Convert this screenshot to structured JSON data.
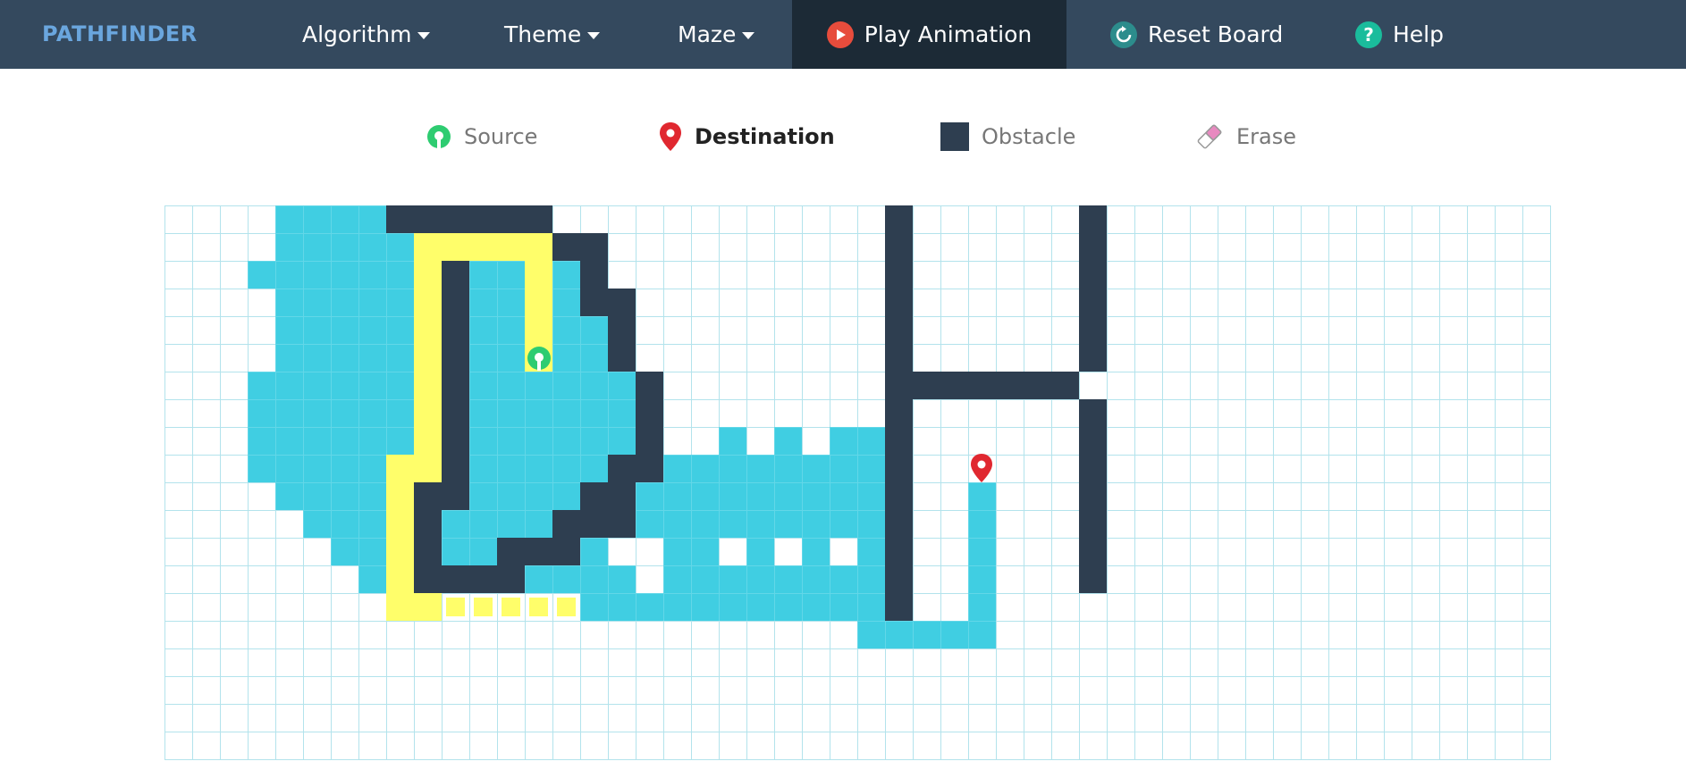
{
  "brand": "PATHFINDER",
  "nav": {
    "algorithm": "Algorithm",
    "theme": "Theme",
    "maze": "Maze",
    "play": "Play Animation",
    "reset": "Reset Board",
    "help": "Help"
  },
  "legend": {
    "source": "Source",
    "destination": "Destination",
    "obstacle": "Obstacle",
    "erase": "Erase"
  },
  "colors": {
    "nav_bg": "#34495e",
    "nav_active": "#1c2a36",
    "wall": "#2e3e50",
    "visited": "#40cee2",
    "path": "#fffe6a",
    "source": "#2ecc71",
    "destination": "#e02830",
    "grid_line": "#b3e3ec"
  },
  "grid": {
    "cols": 50,
    "rows": 20,
    "source": [
      13,
      5
    ],
    "destination": [
      29,
      10
    ],
    "walls": [
      [
        8,
        0
      ],
      [
        9,
        0
      ],
      [
        10,
        0
      ],
      [
        11,
        0
      ],
      [
        12,
        0
      ],
      [
        13,
        0
      ],
      [
        26,
        0
      ],
      [
        33,
        0
      ],
      [
        14,
        1
      ],
      [
        15,
        1
      ],
      [
        26,
        1
      ],
      [
        33,
        1
      ],
      [
        10,
        2
      ],
      [
        15,
        2
      ],
      [
        26,
        2
      ],
      [
        33,
        2
      ],
      [
        10,
        3
      ],
      [
        15,
        3
      ],
      [
        16,
        3
      ],
      [
        26,
        3
      ],
      [
        33,
        3
      ],
      [
        10,
        4
      ],
      [
        16,
        4
      ],
      [
        26,
        4
      ],
      [
        33,
        4
      ],
      [
        10,
        5
      ],
      [
        16,
        5
      ],
      [
        26,
        5
      ],
      [
        33,
        5
      ],
      [
        10,
        6
      ],
      [
        17,
        6
      ],
      [
        26,
        6
      ],
      [
        27,
        6
      ],
      [
        28,
        6
      ],
      [
        29,
        6
      ],
      [
        30,
        6
      ],
      [
        31,
        6
      ],
      [
        32,
        6
      ],
      [
        10,
        7
      ],
      [
        17,
        7
      ],
      [
        26,
        7
      ],
      [
        33,
        7
      ],
      [
        10,
        8
      ],
      [
        17,
        8
      ],
      [
        26,
        8
      ],
      [
        33,
        8
      ],
      [
        10,
        9
      ],
      [
        16,
        9
      ],
      [
        17,
        9
      ],
      [
        26,
        9
      ],
      [
        33,
        9
      ],
      [
        9,
        10
      ],
      [
        10,
        10
      ],
      [
        15,
        10
      ],
      [
        16,
        10
      ],
      [
        26,
        10
      ],
      [
        33,
        10
      ],
      [
        9,
        11
      ],
      [
        14,
        11
      ],
      [
        15,
        11
      ],
      [
        16,
        11
      ],
      [
        26,
        11
      ],
      [
        33,
        11
      ],
      [
        9,
        12
      ],
      [
        12,
        12
      ],
      [
        13,
        12
      ],
      [
        14,
        12
      ],
      [
        26,
        12
      ],
      [
        33,
        12
      ],
      [
        9,
        13
      ],
      [
        10,
        13
      ],
      [
        11,
        13
      ],
      [
        12,
        13
      ],
      [
        26,
        13
      ],
      [
        33,
        13
      ],
      [
        26,
        14
      ]
    ],
    "path": [
      [
        9,
        1
      ],
      [
        10,
        1
      ],
      [
        11,
        1
      ],
      [
        12,
        1
      ],
      [
        13,
        1
      ],
      [
        9,
        2
      ],
      [
        13,
        2
      ],
      [
        9,
        3
      ],
      [
        13,
        3
      ],
      [
        9,
        4
      ],
      [
        13,
        4
      ],
      [
        9,
        5
      ],
      [
        13,
        5
      ],
      [
        9,
        6
      ],
      [
        9,
        7
      ],
      [
        9,
        8
      ],
      [
        8,
        9
      ],
      [
        9,
        9
      ],
      [
        8,
        10
      ],
      [
        8,
        11
      ],
      [
        8,
        12
      ],
      [
        8,
        13
      ],
      [
        8,
        14
      ],
      [
        9,
        14
      ]
    ],
    "path_small": [
      [
        10,
        14
      ],
      [
        11,
        14
      ],
      [
        12,
        14
      ],
      [
        13,
        14
      ],
      [
        14,
        14
      ]
    ],
    "visited_rows": [
      [
        0,
        [
          [
            4,
            7
          ]
        ]
      ],
      [
        1,
        [
          [
            4,
            8
          ]
        ]
      ],
      [
        2,
        [
          [
            3,
            8
          ],
          [
            11,
            14
          ]
        ]
      ],
      [
        3,
        [
          [
            4,
            8
          ],
          [
            11,
            12
          ],
          [
            14,
            14
          ]
        ]
      ],
      [
        4,
        [
          [
            4,
            8
          ],
          [
            11,
            12
          ],
          [
            14,
            15
          ]
        ]
      ],
      [
        5,
        [
          [
            4,
            8
          ],
          [
            11,
            12
          ],
          [
            14,
            15
          ]
        ]
      ],
      [
        6,
        [
          [
            3,
            8
          ],
          [
            11,
            16
          ]
        ]
      ],
      [
        7,
        [
          [
            3,
            8
          ],
          [
            11,
            16
          ]
        ]
      ],
      [
        8,
        [
          [
            3,
            8
          ],
          [
            11,
            16
          ],
          [
            20,
            20
          ],
          [
            22,
            22
          ],
          [
            24,
            25
          ]
        ]
      ],
      [
        9,
        [
          [
            3,
            7
          ],
          [
            11,
            15
          ],
          [
            18,
            25
          ]
        ]
      ],
      [
        10,
        [
          [
            4,
            7
          ],
          [
            11,
            14
          ],
          [
            17,
            25
          ],
          [
            29,
            29
          ]
        ]
      ],
      [
        11,
        [
          [
            5,
            7
          ],
          [
            10,
            13
          ],
          [
            17,
            25
          ],
          [
            29,
            29
          ]
        ]
      ],
      [
        12,
        [
          [
            6,
            7
          ],
          [
            10,
            11
          ],
          [
            15,
            16
          ],
          [
            18,
            25
          ],
          [
            29,
            29
          ]
        ]
      ],
      [
        13,
        [
          [
            7,
            7
          ],
          [
            13,
            16
          ],
          [
            18,
            25
          ],
          [
            29,
            29
          ]
        ]
      ],
      [
        14,
        [
          [
            15,
            25
          ],
          [
            29,
            29
          ]
        ]
      ],
      [
        15,
        [
          [
            25,
            29
          ]
        ]
      ]
    ],
    "visited_holes": [
      [
        16,
        12
      ],
      [
        20,
        12
      ],
      [
        22,
        12
      ],
      [
        24,
        12
      ]
    ]
  }
}
